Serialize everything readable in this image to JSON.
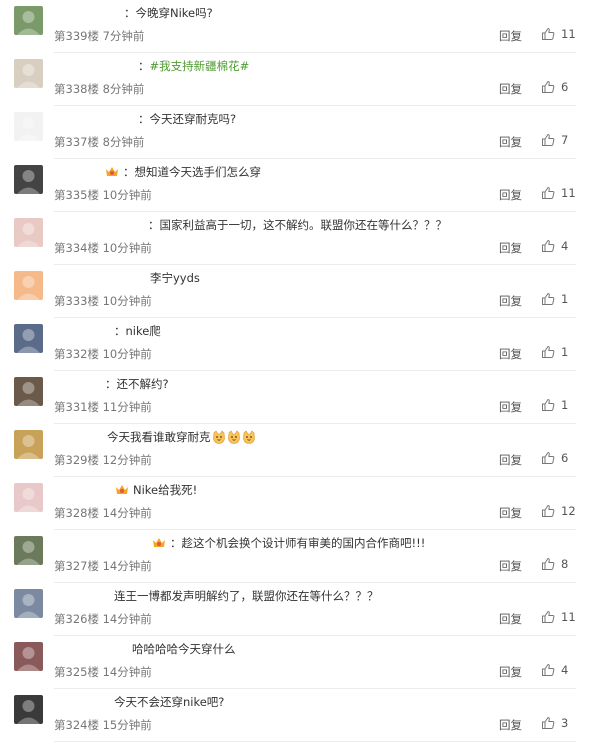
{
  "ui": {
    "reply_label": "回复"
  },
  "comments": [
    {
      "prefix": "：",
      "text": "今晚穿Nike吗?",
      "topic": "",
      "badge": false,
      "emojis": 0,
      "floor": "第339楼",
      "time": "7分钟前",
      "likes": "11",
      "avatar_color": "#7a9a6a",
      "text_x": 124
    },
    {
      "prefix": "：",
      "text": "",
      "topic": "#我支持新疆棉花#",
      "badge": false,
      "emojis": 0,
      "floor": "第338楼",
      "time": "8分钟前",
      "likes": "6",
      "avatar_color": "#d8cfc0",
      "text_x": 138
    },
    {
      "prefix": "：",
      "text": "今天还穿耐克吗?",
      "topic": "",
      "badge": false,
      "emojis": 0,
      "floor": "第337楼",
      "time": "8分钟前",
      "likes": "7",
      "avatar_color": "#f2f2f2",
      "text_x": 138
    },
    {
      "prefix": "：",
      "text": "想知道今天选手们怎么穿",
      "topic": "",
      "badge": true,
      "emojis": 0,
      "floor": "第335楼",
      "time": "10分钟前",
      "likes": "11",
      "avatar_color": "#444444",
      "text_x": 105
    },
    {
      "prefix": "：",
      "text": "国家利益高于一切，这不解约。联盟你还在等什么？？？",
      "topic": "",
      "badge": false,
      "emojis": 0,
      "floor": "第334楼",
      "time": "10分钟前",
      "likes": "4",
      "avatar_color": "#e9c9c4",
      "text_x": 148
    },
    {
      "prefix": "",
      "text": "李宁yyds",
      "topic": "",
      "badge": false,
      "emojis": 0,
      "floor": "第333楼",
      "time": "10分钟前",
      "likes": "1",
      "avatar_color": "#f5b98a",
      "text_x": 150
    },
    {
      "prefix": "：",
      "text": "nike爬",
      "topic": "",
      "badge": false,
      "emojis": 0,
      "floor": "第332楼",
      "time": "10分钟前",
      "likes": "1",
      "avatar_color": "#5b6b8a",
      "text_x": 114
    },
    {
      "prefix": "：",
      "text": "还不解约?",
      "topic": "",
      "badge": false,
      "emojis": 0,
      "floor": "第331楼",
      "time": "11分钟前",
      "likes": "1",
      "avatar_color": "#6b5a4a",
      "text_x": 105
    },
    {
      "prefix": "",
      "text": "今天我看谁敢穿耐克",
      "topic": "",
      "badge": false,
      "emojis": 3,
      "floor": "第329楼",
      "time": "12分钟前",
      "likes": "6",
      "avatar_color": "#c9a25a",
      "text_x": 107
    },
    {
      "prefix": "",
      "text": "Nike给我死!",
      "topic": "",
      "badge": true,
      "emojis": 0,
      "floor": "第328楼",
      "time": "14分钟前",
      "likes": "12",
      "avatar_color": "#e8c8c8",
      "text_x": 115
    },
    {
      "prefix": "：",
      "text": "趁这个机会换个设计师有审美的国内合作商吧!!!",
      "topic": "",
      "badge": true,
      "emojis": 0,
      "floor": "第327楼",
      "time": "14分钟前",
      "likes": "8",
      "avatar_color": "#6a7a5a",
      "text_x": 152
    },
    {
      "prefix": "",
      "text": "连王一博都发声明解约了，联盟你还在等什么？？？",
      "topic": "",
      "badge": false,
      "emojis": 0,
      "floor": "第326楼",
      "time": "14分钟前",
      "likes": "11",
      "avatar_color": "#7b8aa0",
      "text_x": 114
    },
    {
      "prefix": "",
      "text": "哈哈哈哈今天穿什么",
      "topic": "",
      "badge": false,
      "emojis": 0,
      "floor": "第325楼",
      "time": "14分钟前",
      "likes": "4",
      "avatar_color": "#8a5a5a",
      "text_x": 132
    },
    {
      "prefix": "",
      "text": "今天不会还穿nike吧?",
      "topic": "",
      "badge": false,
      "emojis": 0,
      "floor": "第324楼",
      "time": "15分钟前",
      "likes": "3",
      "avatar_color": "#3a3a3a",
      "text_x": 114
    }
  ]
}
